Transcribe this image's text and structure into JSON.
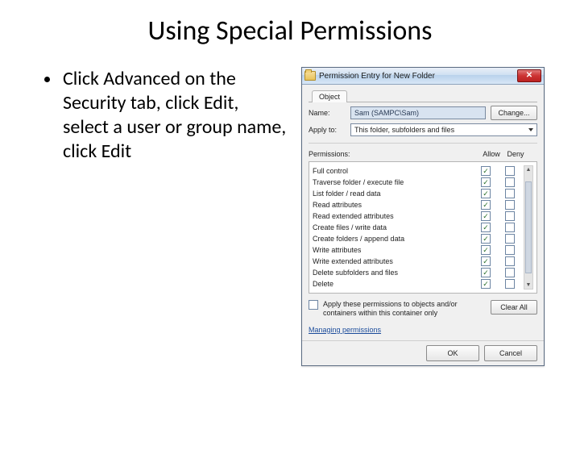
{
  "title": "Using Special Permissions",
  "bullet": "Click Advanced on the Security tab, click Edit, select a user or group name, click Edit",
  "dialog": {
    "title": "Permission Entry for New Folder",
    "tab": "Object",
    "name_label": "Name:",
    "name_value": "Sam (SAMPC\\Sam)",
    "change_btn": "Change...",
    "apply_to_label": "Apply to:",
    "apply_to_value": "This folder, subfolders and files",
    "permissions_label": "Permissions:",
    "col_allow": "Allow",
    "col_deny": "Deny",
    "rows": [
      {
        "label": "Full control",
        "allow": true,
        "deny": false
      },
      {
        "label": "Traverse folder / execute file",
        "allow": true,
        "deny": false
      },
      {
        "label": "List folder / read data",
        "allow": true,
        "deny": false
      },
      {
        "label": "Read attributes",
        "allow": true,
        "deny": false
      },
      {
        "label": "Read extended attributes",
        "allow": true,
        "deny": false
      },
      {
        "label": "Create files / write data",
        "allow": true,
        "deny": false
      },
      {
        "label": "Create folders / append data",
        "allow": true,
        "deny": false
      },
      {
        "label": "Write attributes",
        "allow": true,
        "deny": false
      },
      {
        "label": "Write extended attributes",
        "allow": true,
        "deny": false
      },
      {
        "label": "Delete subfolders and files",
        "allow": true,
        "deny": false
      },
      {
        "label": "Delete",
        "allow": true,
        "deny": false
      }
    ],
    "apply_inherit": "Apply these permissions to objects and/or containers within this container only",
    "clear_all_btn": "Clear All",
    "manage_link": "Managing permissions",
    "ok_btn": "OK",
    "cancel_btn": "Cancel"
  }
}
